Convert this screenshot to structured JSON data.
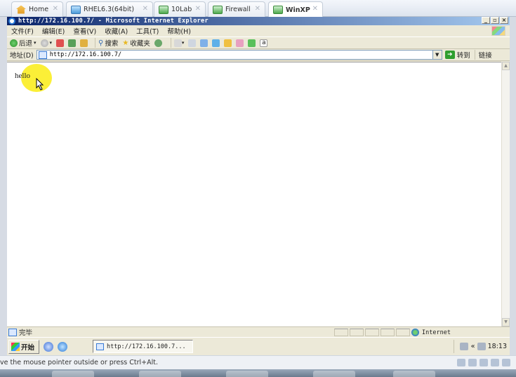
{
  "host_tabs": [
    {
      "label": "Home"
    },
    {
      "label": "RHEL6.3(64bit)"
    },
    {
      "label": "10Lab"
    },
    {
      "label": "Firewall"
    },
    {
      "label": "WinXP"
    }
  ],
  "ie": {
    "title": "http://172.16.100.7/ - Microsoft Internet Explorer",
    "menu": [
      "文件(F)",
      "编辑(E)",
      "查看(V)",
      "收藏(A)",
      "工具(T)",
      "帮助(H)"
    ],
    "toolbar": {
      "back_label": "后退",
      "search_label": "搜索",
      "favorites_label": "收藏夹"
    },
    "address": {
      "label": "地址(D)",
      "value": "http://172.16.100.7/",
      "go_label": "转到",
      "links_label": "链接"
    },
    "page": {
      "text": "hello"
    },
    "status": {
      "text": "完毕",
      "zone": "Internet"
    }
  },
  "xp_taskbar": {
    "start_label": "开始",
    "task_label": "http://172.16.100.7...",
    "clock": "18:13"
  },
  "vm_status": {
    "text": "ve the mouse pointer outside or press Ctrl+Alt."
  }
}
